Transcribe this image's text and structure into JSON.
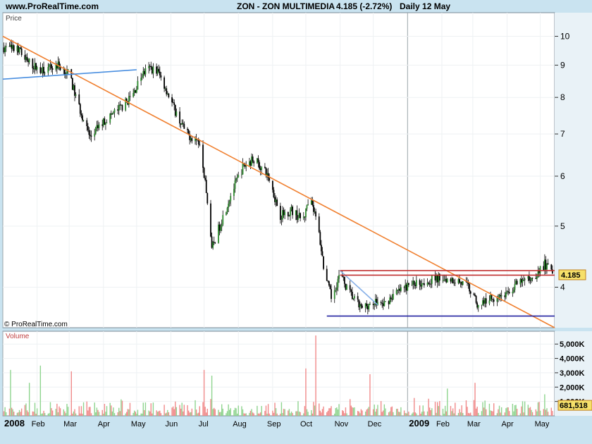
{
  "header": {
    "site": "www.ProRealTime.com",
    "instrument": "ZON - ZON MULTIMEDIA",
    "change": "4.185 (-2.72%)",
    "period": "Daily  12 May"
  },
  "chart_data": [
    {
      "type": "candlestick",
      "panel_label": "Price",
      "watermark": "© ProRealTime.com",
      "last_price_label": "4.185",
      "y_scale": "log",
      "ylim": [
        3.45,
        10.9
      ],
      "y_ticks": [
        4,
        5,
        6,
        7,
        8,
        9,
        10
      ],
      "x_range": [
        "2008-01-01",
        "2009-05-14"
      ],
      "x_ticks": [
        {
          "date": "2008-01-01",
          "label": "2008"
        },
        {
          "date": "2008-02-01",
          "label": "Feb"
        },
        {
          "date": "2008-03-01",
          "label": "Mar"
        },
        {
          "date": "2008-04-01",
          "label": "Apr"
        },
        {
          "date": "2008-05-01",
          "label": "May"
        },
        {
          "date": "2008-06-01",
          "label": "Jun"
        },
        {
          "date": "2008-07-01",
          "label": "Jul"
        },
        {
          "date": "2008-08-01",
          "label": "Aug"
        },
        {
          "date": "2008-09-01",
          "label": "Sep"
        },
        {
          "date": "2008-10-01",
          "label": "Oct"
        },
        {
          "date": "2008-11-01",
          "label": "Nov"
        },
        {
          "date": "2008-12-01",
          "label": "Dec"
        },
        {
          "date": "2009-01-01",
          "label": "2009"
        },
        {
          "date": "2009-02-01",
          "label": "Feb"
        },
        {
          "date": "2009-03-01",
          "label": "Mar"
        },
        {
          "date": "2009-04-01",
          "label": "Apr"
        },
        {
          "date": "2009-05-01",
          "label": "May"
        }
      ],
      "close_path": [
        [
          "2008-01-02",
          9.6
        ],
        [
          "2008-01-15",
          9.5
        ],
        [
          "2008-01-28",
          9.0
        ],
        [
          "2008-02-05",
          8.8
        ],
        [
          "2008-02-20",
          9.0
        ],
        [
          "2008-03-01",
          8.7
        ],
        [
          "2008-03-08",
          7.9
        ],
        [
          "2008-03-15",
          7.3
        ],
        [
          "2008-03-20",
          6.9
        ],
        [
          "2008-03-28",
          7.2
        ],
        [
          "2008-04-08",
          7.5
        ],
        [
          "2008-04-20",
          7.8
        ],
        [
          "2008-04-28",
          8.1
        ],
        [
          "2008-05-06",
          8.7
        ],
        [
          "2008-05-13",
          8.9
        ],
        [
          "2008-05-20",
          8.8
        ],
        [
          "2008-05-27",
          8.3
        ],
        [
          "2008-06-05",
          7.6
        ],
        [
          "2008-06-15",
          7.0
        ],
        [
          "2008-06-28",
          6.8
        ],
        [
          "2008-07-03",
          5.6
        ],
        [
          "2008-07-08",
          4.6
        ],
        [
          "2008-07-15",
          5.0
        ],
        [
          "2008-07-25",
          5.6
        ],
        [
          "2008-08-05",
          6.2
        ],
        [
          "2008-08-15",
          6.4
        ],
        [
          "2008-08-28",
          6.0
        ],
        [
          "2008-09-08",
          5.2
        ],
        [
          "2008-09-18",
          5.3
        ],
        [
          "2008-09-28",
          5.1
        ],
        [
          "2008-10-05",
          5.5
        ],
        [
          "2008-10-12",
          5.0
        ],
        [
          "2008-10-18",
          4.2
        ],
        [
          "2008-10-24",
          3.85
        ],
        [
          "2008-11-01",
          4.2
        ],
        [
          "2008-11-08",
          3.95
        ],
        [
          "2008-11-20",
          3.7
        ],
        [
          "2008-12-01",
          3.8
        ],
        [
          "2008-12-10",
          3.75
        ],
        [
          "2008-12-20",
          3.9
        ],
        [
          "2009-01-05",
          4.05
        ],
        [
          "2009-01-20",
          4.1
        ],
        [
          "2009-02-01",
          4.15
        ],
        [
          "2009-02-15",
          4.1
        ],
        [
          "2009-02-25",
          4.0
        ],
        [
          "2009-03-05",
          3.75
        ],
        [
          "2009-03-18",
          3.85
        ],
        [
          "2009-04-01",
          3.9
        ],
        [
          "2009-04-10",
          4.05
        ],
        [
          "2009-04-25",
          4.15
        ],
        [
          "2009-05-05",
          4.35
        ],
        [
          "2009-05-12",
          4.185
        ]
      ],
      "trendlines": [
        {
          "color": "#f08030",
          "from": [
            "2008-01-01",
            10.0
          ],
          "to": [
            "2009-05-14",
            3.45
          ]
        },
        {
          "color": "#4a8fe0",
          "from": [
            "2008-01-01",
            8.55
          ],
          "to": [
            "2008-05-01",
            8.85
          ]
        },
        {
          "color": "#87b0e8",
          "from": [
            "2008-11-01",
            4.25
          ],
          "to": [
            "2008-12-05",
            3.75
          ]
        },
        {
          "color": "#c03030",
          "from": [
            "2008-11-01",
            4.25
          ],
          "to": [
            "2009-05-14",
            4.25
          ]
        },
        {
          "color": "#c03030",
          "from": [
            "2008-11-01",
            4.18
          ],
          "to": [
            "2009-05-14",
            4.18
          ]
        },
        {
          "color": "#2020a0",
          "from": [
            "2008-10-20",
            3.6
          ],
          "to": [
            "2009-05-14",
            3.6
          ]
        }
      ]
    },
    {
      "type": "bar",
      "panel_label": "Volume",
      "last_value_label": "681,518",
      "ylim": [
        0,
        5600000
      ],
      "y_ticks": [
        {
          "value": 1000000,
          "label": "1,000K"
        },
        {
          "value": 2000000,
          "label": "2,000K"
        },
        {
          "value": 3000000,
          "label": "3,000K"
        },
        {
          "value": 4000000,
          "label": "4,000K"
        },
        {
          "value": 5000000,
          "label": "5,000K"
        }
      ],
      "up_color": "#8fd48f",
      "down_color": "#f08a8a",
      "spikes": [
        {
          "date": "2008-01-08",
          "value": 3200000,
          "up": true
        },
        {
          "date": "2008-01-25",
          "value": 2300000,
          "up": true
        },
        {
          "date": "2008-02-04",
          "value": 3500000,
          "up": true
        },
        {
          "date": "2008-03-03",
          "value": 3100000,
          "up": false
        },
        {
          "date": "2008-05-10",
          "value": 2400000,
          "up": true
        },
        {
          "date": "2008-07-01",
          "value": 3200000,
          "up": false
        },
        {
          "date": "2008-07-08",
          "value": 2800000,
          "up": true
        },
        {
          "date": "2008-10-01",
          "value": 3300000,
          "up": false
        },
        {
          "date": "2008-10-10",
          "value": 5600000,
          "up": false
        },
        {
          "date": "2008-11-28",
          "value": 2900000,
          "up": false
        },
        {
          "date": "2009-02-06",
          "value": 1900000,
          "up": true
        },
        {
          "date": "2009-03-03",
          "value": 2300000,
          "up": false
        },
        {
          "date": "2009-05-05",
          "value": 1500000,
          "up": true
        }
      ]
    }
  ]
}
